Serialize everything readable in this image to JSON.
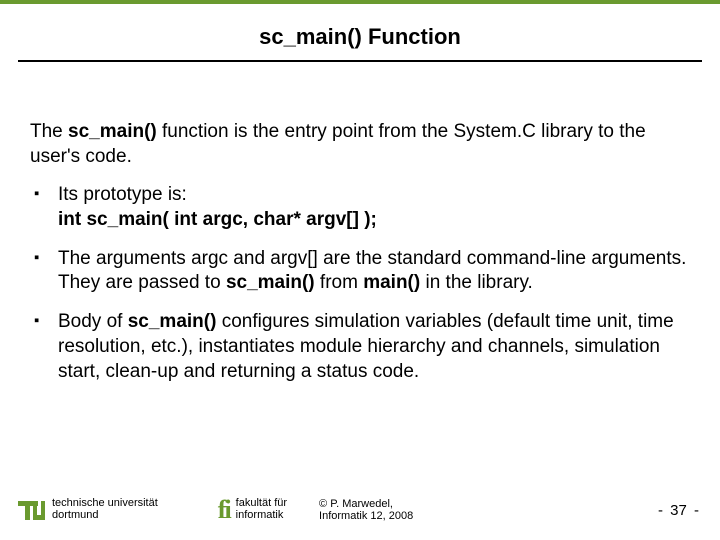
{
  "title": "sc_main() Function",
  "intro": {
    "pre": "The ",
    "bold": "sc_main()",
    "post": " function is the entry point from the System.C library to the user's code."
  },
  "bullets": {
    "0": {
      "line1": "Its prototype is:",
      "proto": "int sc_main( int argc, char* argv[] );"
    },
    "1": {
      "pre": "The arguments argc and argv[] are the standard command-line arguments. They are passed to ",
      "b1": "sc_main()",
      "mid": " from ",
      "b2": "main()",
      "post": " in the library."
    },
    "2": {
      "pre": "Body of ",
      "b1": "sc_main()",
      "post": " configures simulation variables (default time unit, time resolution, etc.), instantiates module hierarchy and channels, simulation start, clean-up and returning a status code."
    }
  },
  "footer": {
    "uni1": "technische universität",
    "uni2": "dortmund",
    "fak1": "fakultät für",
    "fak2": "informatik",
    "attr1": "© P. Marwedel,",
    "attr2": "Informatik 12,  2008",
    "page": "37"
  }
}
